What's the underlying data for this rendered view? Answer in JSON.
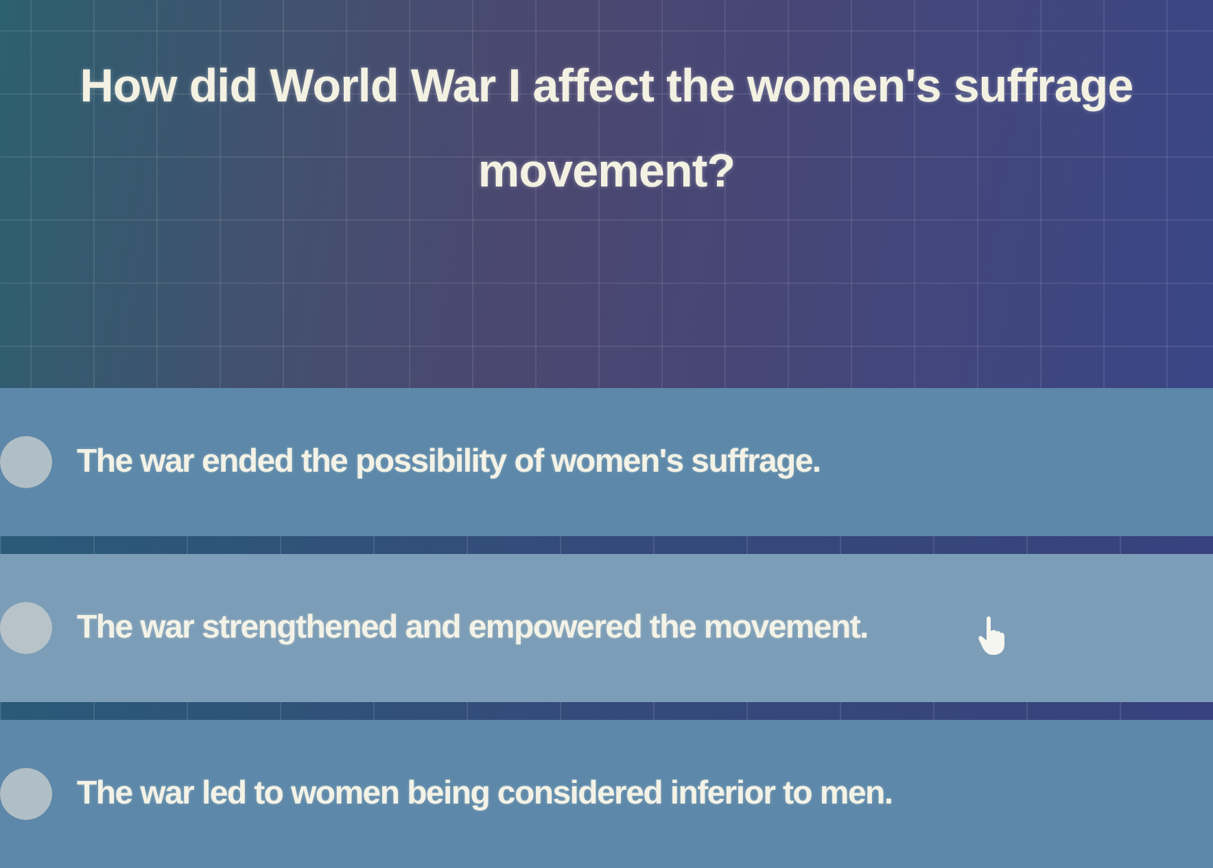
{
  "question": {
    "text": "How did World War I affect the women's suffrage movement?"
  },
  "options": [
    {
      "label": "The war ended the possibility of women's suffrage.",
      "selected": false,
      "hovered": false
    },
    {
      "label": "The war strengthened and empowered the movement.",
      "selected": false,
      "hovered": true
    },
    {
      "label": "The war led to women being considered inferior to men.",
      "selected": false,
      "hovered": false
    }
  ]
}
